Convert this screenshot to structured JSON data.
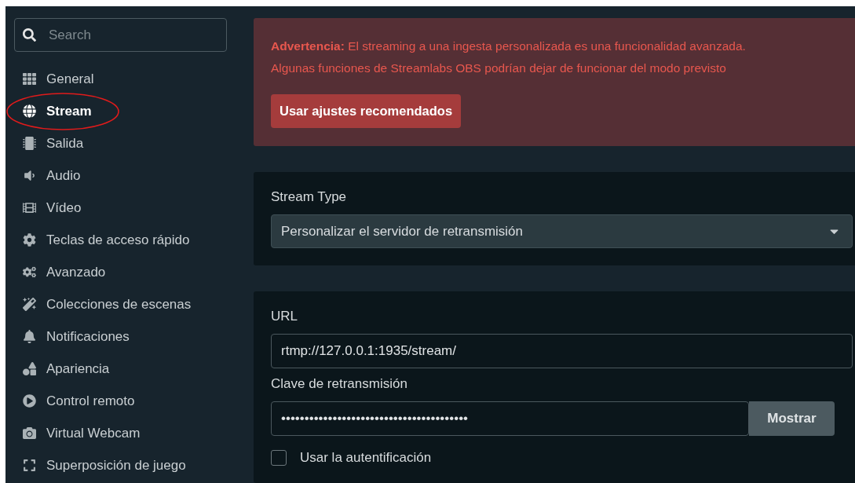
{
  "sidebar": {
    "search": {
      "placeholder": "Search"
    },
    "items": [
      {
        "label": "General",
        "selected": false,
        "circled": false
      },
      {
        "label": "Stream",
        "selected": true,
        "circled": true
      },
      {
        "label": "Salida",
        "selected": false,
        "circled": false
      },
      {
        "label": "Audio",
        "selected": false,
        "circled": false
      },
      {
        "label": "Vídeo",
        "selected": false,
        "circled": false
      },
      {
        "label": "Teclas de acceso rápido",
        "selected": false,
        "circled": false
      },
      {
        "label": "Avanzado",
        "selected": false,
        "circled": false
      },
      {
        "label": "Colecciones de escenas",
        "selected": false,
        "circled": false
      },
      {
        "label": "Notificaciones",
        "selected": false,
        "circled": false
      },
      {
        "label": "Apariencia",
        "selected": false,
        "circled": false
      },
      {
        "label": "Control remoto",
        "selected": false,
        "circled": false
      },
      {
        "label": "Virtual Webcam",
        "selected": false,
        "circled": false
      },
      {
        "label": "Superposición de juego",
        "selected": false,
        "circled": false
      }
    ]
  },
  "warning": {
    "lines": [
      "**Advertencia:** El streaming a una ingesta personalizada es una funcionalidad avanzada.",
      "Algunas funciones de Streamlabs OBS podrían dejar de funcionar del modo previsto"
    ],
    "button": "Usar ajustes recomendados"
  },
  "stream_type": {
    "label": "Stream Type",
    "value": "Personalizar el servidor de retransmisión"
  },
  "server": {
    "url_label": "URL",
    "url_value": "rtmp://127.0.0.1:1935/stream/",
    "key_label": "Clave de retransmisión",
    "key_value": "••••••••••••••••••••••••••••••••••••••••",
    "show_button": "Mostrar",
    "auth": {
      "label": "Usar la autentificación",
      "checked": false
    }
  }
}
